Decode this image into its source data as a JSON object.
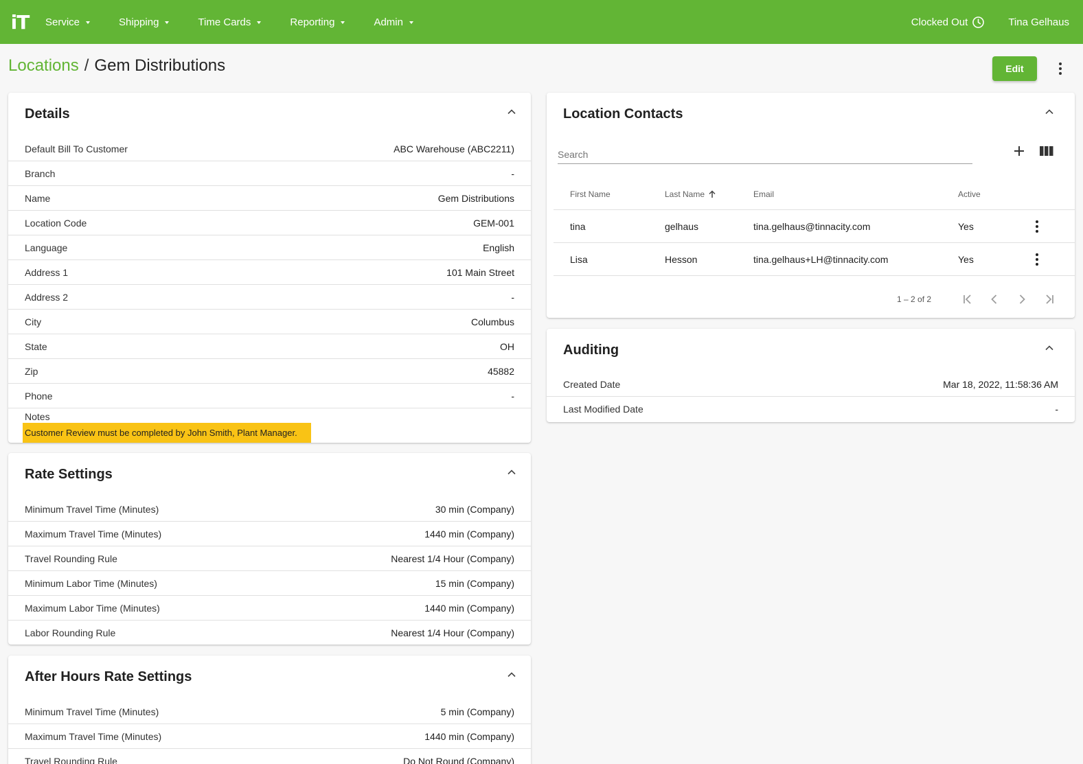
{
  "app": {
    "logo_text": "iT"
  },
  "nav": {
    "items": [
      {
        "label": "Service"
      },
      {
        "label": "Shipping"
      },
      {
        "label": "Time Cards"
      },
      {
        "label": "Reporting"
      },
      {
        "label": "Admin"
      }
    ],
    "clock_status": "Clocked Out",
    "user_name": "Tina Gelhaus"
  },
  "header": {
    "breadcrumb_parent": "Locations",
    "breadcrumb_separator": "/",
    "breadcrumb_current": "Gem Distributions",
    "edit_label": "Edit"
  },
  "details": {
    "title": "Details",
    "rows": [
      {
        "label": "Default Bill To Customer",
        "value": "ABC Warehouse (ABC2211)"
      },
      {
        "label": "Branch",
        "value": "-"
      },
      {
        "label": "Name",
        "value": "Gem Distributions"
      },
      {
        "label": "Location Code",
        "value": "GEM-001"
      },
      {
        "label": "Language",
        "value": "English"
      },
      {
        "label": "Address 1",
        "value": "101 Main Street"
      },
      {
        "label": "Address 2",
        "value": "-"
      },
      {
        "label": "City",
        "value": "Columbus"
      },
      {
        "label": "State",
        "value": "OH"
      },
      {
        "label": "Zip",
        "value": "45882"
      },
      {
        "label": "Phone",
        "value": "-"
      }
    ],
    "notes_label": "Notes",
    "notes_text": "Customer Review must be completed by John Smith, Plant Manager."
  },
  "rate_settings": {
    "title": "Rate Settings",
    "rows": [
      {
        "label": "Minimum Travel Time (Minutes)",
        "value": "30 min (Company)"
      },
      {
        "label": "Maximum Travel Time (Minutes)",
        "value": "1440 min (Company)"
      },
      {
        "label": "Travel Rounding Rule",
        "value": "Nearest 1/4 Hour (Company)"
      },
      {
        "label": "Minimum Labor Time (Minutes)",
        "value": "15 min (Company)"
      },
      {
        "label": "Maximum Labor Time (Minutes)",
        "value": "1440 min (Company)"
      },
      {
        "label": "Labor Rounding Rule",
        "value": "Nearest 1/4 Hour (Company)"
      }
    ]
  },
  "after_hours": {
    "title": "After Hours Rate Settings",
    "rows": [
      {
        "label": "Minimum Travel Time (Minutes)",
        "value": "5 min (Company)"
      },
      {
        "label": "Maximum Travel Time (Minutes)",
        "value": "1440 min (Company)"
      },
      {
        "label": "Travel Rounding Rule",
        "value": "Do Not Round (Company)"
      }
    ]
  },
  "contacts": {
    "title": "Location Contacts",
    "search_placeholder": "Search",
    "columns": {
      "first": "First Name",
      "last": "Last Name",
      "email": "Email",
      "active": "Active"
    },
    "rows": [
      {
        "first": "tina",
        "last": "gelhaus",
        "email": "tina.gelhaus@tinnacity.com",
        "active": "Yes"
      },
      {
        "first": "Lisa",
        "last": "Hesson",
        "email": "tina.gelhaus+LH@tinnacity.com",
        "active": "Yes"
      }
    ],
    "range": "1 – 2 of 2"
  },
  "auditing": {
    "title": "Auditing",
    "rows": [
      {
        "label": "Created Date",
        "value": "Mar 18, 2022, 11:58:36 AM"
      },
      {
        "label": "Last Modified Date",
        "value": "-"
      }
    ]
  },
  "colors": {
    "brand_green": "#62b535",
    "notes_highlight": "#f9c315"
  }
}
